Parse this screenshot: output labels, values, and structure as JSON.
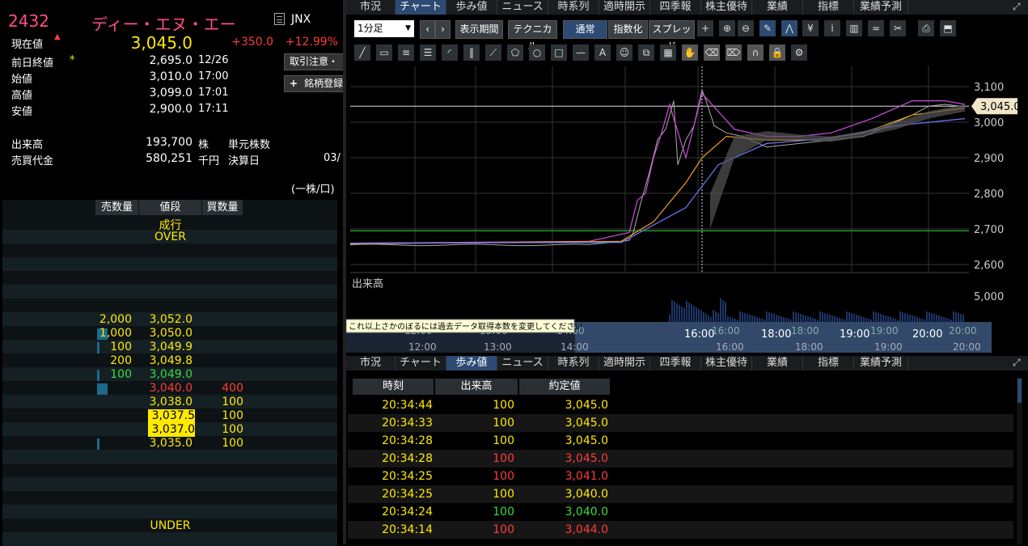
{
  "quote": {
    "code": "2432",
    "name": "ディー・エヌ・エー",
    "market_icon": "document-icon",
    "market": "JNX",
    "current_label": "現在値",
    "current_arrow": "▲",
    "current_value": "3,045.0",
    "change": "+350.0",
    "change_pct": "+12.99%",
    "rows": [
      {
        "label": "前日終値",
        "mark": "*",
        "value": "2,695.0",
        "time": "12/26"
      },
      {
        "label": "始値",
        "mark": "",
        "value": "3,010.0",
        "time": "17:00"
      },
      {
        "label": "高値",
        "mark": "",
        "value": "3,099.0",
        "time": "17:01"
      },
      {
        "label": "安値",
        "mark": "",
        "value": "2,900.0",
        "time": "17:11"
      }
    ],
    "volume_label": "出来高",
    "volume_value": "193,700",
    "volume_unit": "株",
    "unit_shares_label": "単元株数",
    "turnover_label": "売買代金",
    "turnover_value": "580,251",
    "turnover_unit": "千円",
    "settlement_label": "決算日",
    "settlement_value": "03/",
    "per_unit": "(一株/口)",
    "btn_caution": "取引注意・",
    "btn_register_icon": "+",
    "btn_register": "銘柄登録"
  },
  "book": {
    "headers": [
      "売数量",
      "値段",
      "買数量"
    ],
    "market_order": "成行",
    "over": "OVER",
    "under": "UNDER",
    "asks": [
      {
        "qty": "2,000",
        "price": "3,052.0",
        "bar": 0
      },
      {
        "qty": "1,000",
        "price": "3,050.0",
        "bar": 0.7
      },
      {
        "qty": "100",
        "price": "3,049.9",
        "bar": 0.15
      },
      {
        "qty": "200",
        "price": "3,049.8",
        "bar": 0
      },
      {
        "qty": "100",
        "price": "3,049.0",
        "bar": 0.15
      }
    ],
    "bids": [
      {
        "price": "3,040.0",
        "qty": "400",
        "bar": 0.7
      },
      {
        "price": "3,038.0",
        "qty": "100",
        "bar": 0
      },
      {
        "price": "3,037.5",
        "qty": "100",
        "bar": 0
      },
      {
        "price": "3,037.0",
        "qty": "100",
        "bar": 0
      },
      {
        "price": "3,035.0",
        "qty": "100",
        "bar": 0.1
      }
    ]
  },
  "tabs_top": [
    "市況",
    "チャート",
    "歩み値",
    "ニュース",
    "時系列",
    "適時開示",
    "四季報",
    "株主優待",
    "業績",
    "指標",
    "業績予測"
  ],
  "tabs_top_active": 1,
  "tabs_bottom": [
    "市況",
    "チャート",
    "歩み値",
    "ニュース",
    "時系列",
    "適時開示",
    "四季報",
    "株主優待",
    "業績",
    "指標",
    "業績予測"
  ],
  "tabs_bottom_active": 2,
  "toolbar": {
    "interval": "1分足",
    "period": "表示期間",
    "technical": "テクニカル",
    "mode_normal": "通常",
    "mode_index": "指数化",
    "mode_spread": "スプレッド"
  },
  "chart": {
    "price_ticks": [
      "3,100",
      "3,000",
      "2,900",
      "2,800",
      "2,700",
      "2,600"
    ],
    "current_tag": "3,045.0",
    "volume_label": "出来高",
    "volume_tick": "5,000",
    "time_ticks": [
      "16:00",
      "18:00",
      "19:00",
      "20:00"
    ],
    "nav_ticks_top": [
      "12:00",
      "13:00",
      "14:00",
      "16:00",
      "18:00",
      "19:00",
      "20:00"
    ],
    "nav_ticks_bottom": [
      "12:00",
      "13:00",
      "14:00",
      "16:00",
      "18:00",
      "19:00",
      "20:00"
    ],
    "tooltip": "これ以上さかのぼるには過去データ取得本数を変更してください"
  },
  "trades": {
    "headers": [
      "時刻",
      "出来高",
      "約定値"
    ],
    "rows": [
      {
        "time": "20:34:44",
        "qty": "100",
        "price": "3,045.0",
        "color": "yellow"
      },
      {
        "time": "20:34:33",
        "qty": "100",
        "price": "3,045.0",
        "color": "yellow"
      },
      {
        "time": "20:34:28",
        "qty": "100",
        "price": "3,045.0",
        "color": "yellow"
      },
      {
        "time": "20:34:28",
        "qty": "100",
        "price": "3,045.0",
        "color": "red"
      },
      {
        "time": "20:34:25",
        "qty": "100",
        "price": "3,041.0",
        "color": "red"
      },
      {
        "time": "20:34:25",
        "qty": "100",
        "price": "3,040.0",
        "color": "yellow"
      },
      {
        "time": "20:34:24",
        "qty": "100",
        "price": "3,040.0",
        "color": "green"
      },
      {
        "time": "20:34:14",
        "qty": "100",
        "price": "3,044.0",
        "color": "red"
      }
    ]
  },
  "colors": {
    "accent": "#2c4a72",
    "up": "#ff3b3b",
    "down": "#3bdc3b",
    "neutral": "#ffe900",
    "code": "#ff4d8d"
  }
}
